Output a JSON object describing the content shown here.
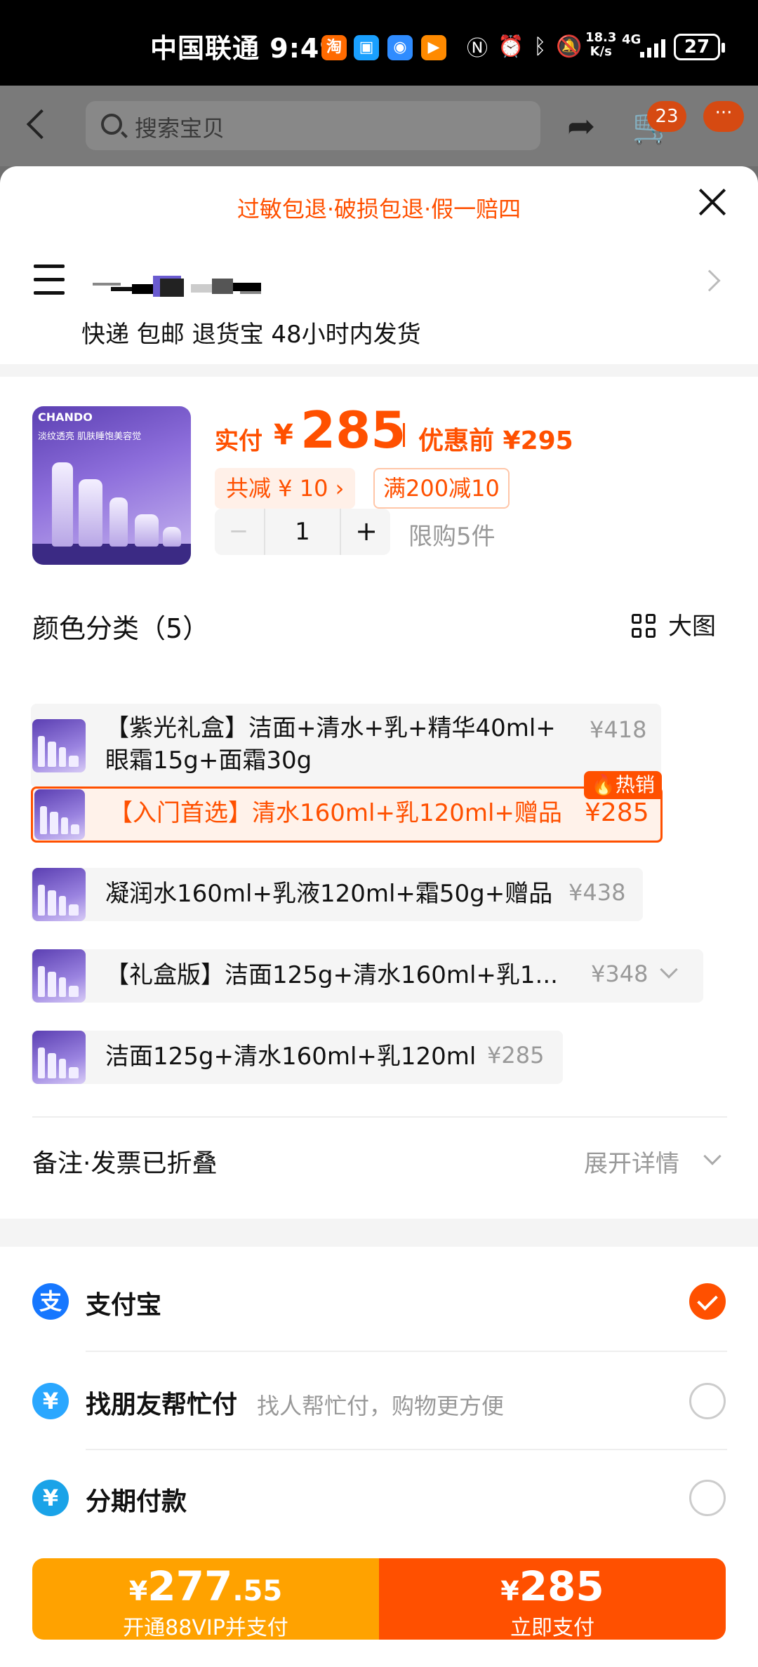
{
  "status_bar": {
    "carrier": "中国联通",
    "time": "9:49",
    "net_speed_value": "18.3",
    "net_speed_unit": "K/s",
    "network": "4G",
    "battery": "27"
  },
  "nav": {
    "search_placeholder": "搜索宝贝",
    "cart_count": "23",
    "more_label": "···"
  },
  "sheet": {
    "guarantee": "过敏包退·破损包退·假一赔四",
    "delivery": "快递 包邮 退货宝 48小时内发货"
  },
  "product": {
    "brand": "CHANDO",
    "image_copy": "淡纹透亮 肌肤睡饱美容觉",
    "actual_label": "实付",
    "currency": "¥",
    "actual_price": "285",
    "before_label": "优惠前 ¥295",
    "discount_total": "共减 ¥ 10 ›",
    "coupon": "满200减10",
    "quantity": "1",
    "minus": "−",
    "plus": "+",
    "limit": "限购5件"
  },
  "options_header": {
    "title": "颜色分类（5）",
    "big_view": "大图"
  },
  "options": [
    {
      "line1": "【紫光礼盒】洁面+清水+乳+精华40ml+",
      "line2": "眼霜15g+面霜30g",
      "price": "¥418"
    },
    {
      "line1": "【入门首选】清水160ml+乳120ml+赠品",
      "price": "¥285",
      "tag": "热销",
      "selected": true
    },
    {
      "line1": "凝润水160ml+乳液120ml+霜50g+赠品",
      "price": "¥438"
    },
    {
      "line1": "【礼盒版】洁面125g+清水160ml+乳1...",
      "price": "¥348"
    },
    {
      "line1": "洁面125g+清水160ml+乳120ml",
      "price": "¥285"
    }
  ],
  "notes": {
    "label": "备注·发票已折叠",
    "expand": "展开详情"
  },
  "payment": [
    {
      "label": "支付宝",
      "icon": "alipay-icon",
      "selected": true
    },
    {
      "label": "找朋友帮忙付",
      "sub": "找人帮忙付，购物更方便",
      "icon": "friend-pay-icon",
      "selected": false
    },
    {
      "label": "分期付款",
      "icon": "installment-icon",
      "selected": false
    }
  ],
  "buttons": {
    "vip_symbol": "¥",
    "vip_int": "277",
    "vip_dec": ".55",
    "vip_label": "开通88VIP并支付",
    "buy_symbol": "¥",
    "buy_price": "285",
    "buy_label": "立即支付"
  },
  "colors": {
    "accent": "#ff5000",
    "vip": "#ffa200",
    "alipay": "#1677ff"
  }
}
